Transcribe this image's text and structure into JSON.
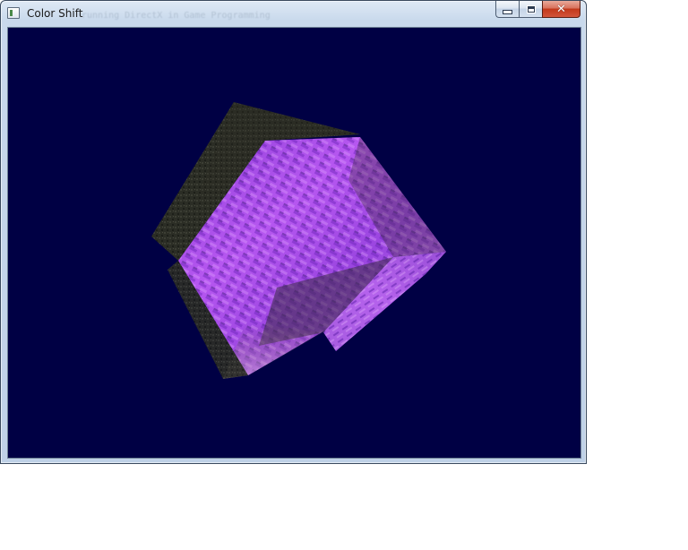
{
  "window": {
    "title": "Color Shift",
    "background_title_ghost": "running DirectX in Game Programming"
  },
  "caption_buttons": {
    "minimize_icon": "minimize-icon",
    "maximize_icon": "maximize-icon",
    "close_icon": "close-icon",
    "close_glyph": "✕"
  },
  "scene": {
    "background_color": "#000044",
    "object": "textured-cube",
    "texture_tint": "#b04bff"
  }
}
